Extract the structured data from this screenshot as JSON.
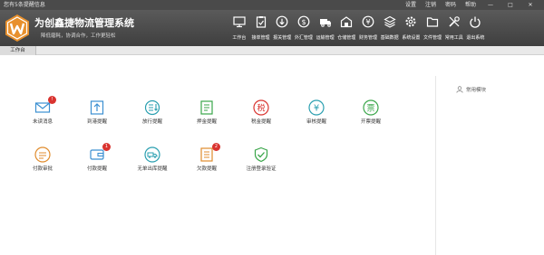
{
  "titlebar": {
    "left": "您有5条提醒信息",
    "links": [
      "设置",
      "注销",
      "密码",
      "帮助"
    ],
    "minimize": "—",
    "maximize": "□",
    "close": "✕"
  },
  "header": {
    "title": "为创鑫捷物流管理系统",
    "subtitle": "降低磨耗，协调合作，工作更轻松"
  },
  "nav": [
    {
      "label": "工作台",
      "icon": "monitor-icon"
    },
    {
      "label": "接单管理",
      "icon": "clipboard-check-icon"
    },
    {
      "label": "报关管理",
      "icon": "download-circle-icon"
    },
    {
      "label": "外汇管理",
      "icon": "dollar-circle-icon"
    },
    {
      "label": "运输管理",
      "icon": "truck-icon"
    },
    {
      "label": "仓储管理",
      "icon": "warehouse-icon"
    },
    {
      "label": "财务管理",
      "icon": "yen-circle-icon"
    },
    {
      "label": "基础数据",
      "icon": "layers-icon"
    },
    {
      "label": "系统设置",
      "icon": "gear-icon"
    },
    {
      "label": "文件管理",
      "icon": "folder-icon"
    },
    {
      "label": "常用工具",
      "icon": "tools-icon"
    },
    {
      "label": "退出系统",
      "icon": "power-icon"
    }
  ],
  "tabs": [
    {
      "label": "工作台"
    }
  ],
  "items": [
    {
      "label": "未读消息",
      "icon": "envelope-icon",
      "badge": "!"
    },
    {
      "label": "到港提醒",
      "icon": "arrow-up-doc-icon",
      "badge": ""
    },
    {
      "label": "放行提醒",
      "icon": "list-download-icon",
      "badge": ""
    },
    {
      "label": "押金提醒",
      "icon": "document-icon",
      "badge": ""
    },
    {
      "label": "税金提醒",
      "icon": "tax-icon",
      "badge": "",
      "glyph": "税"
    },
    {
      "label": "审核提醒",
      "icon": "yen-icon",
      "badge": "",
      "glyph": "¥"
    },
    {
      "label": "开票提醒",
      "icon": "invoice-icon",
      "badge": "",
      "glyph": "票"
    },
    {
      "label": "付款审批",
      "icon": "approval-icon",
      "badge": ""
    },
    {
      "label": "付款提醒",
      "icon": "wallet-icon",
      "badge": "1"
    },
    {
      "label": "无单出库提醒",
      "icon": "truck-alert-icon",
      "badge": ""
    },
    {
      "label": "欠款提醒",
      "icon": "debt-doc-icon",
      "badge": "2"
    },
    {
      "label": "注册登录验证",
      "icon": "shield-check-icon",
      "badge": ""
    }
  ],
  "sidebar": {
    "title": "常用模块"
  },
  "colors": {
    "header_bg": "#4a4a4a",
    "logo_orange": "#e8902c",
    "badge_red": "#d9332f",
    "blue": "#3b8fd1",
    "teal": "#2a9fb0",
    "green": "#3aa64a",
    "red": "#d9332f",
    "orange": "#e08b2c"
  }
}
